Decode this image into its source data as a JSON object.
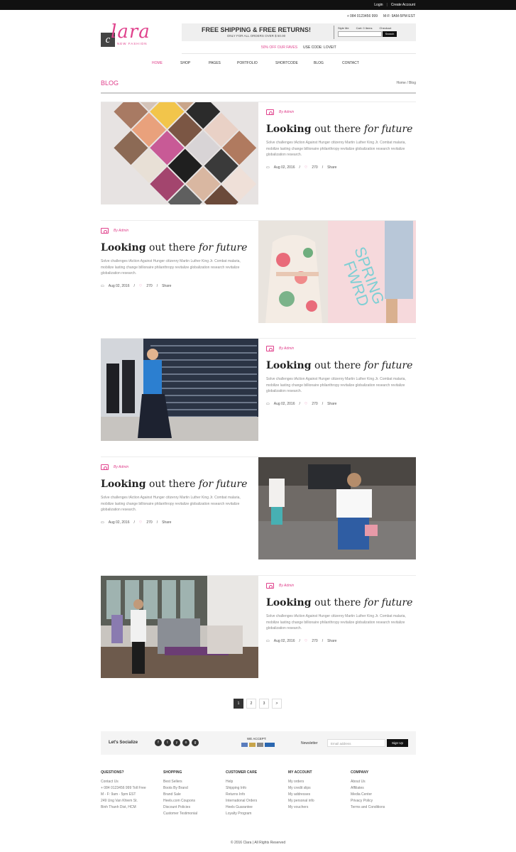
{
  "topbar": {
    "login": "Login",
    "create_account": "Create Account",
    "separator": "|"
  },
  "contact": {
    "phone": "+ 084 0123456 999",
    "hours": "M-F: 9AM-5PM EST"
  },
  "logo": {
    "box_letter": "c",
    "script": "lara",
    "tagline": "NEW FASHION"
  },
  "promo": {
    "headline": "FREE SHIPPING & FREE RETURNS!",
    "sub": "ONLY FOR ALL ORDERS OVER $ 50.00",
    "style_me": "Style Me",
    "cart": "Cart: 0 Items",
    "checkout": "Checkout",
    "search_button": "Search",
    "search_placeholder": ""
  },
  "offer": {
    "sale": "50% OFF OUR FAVES",
    "code": "USE CODE: LOVEIT"
  },
  "nav": [
    "HOME",
    "SHOP",
    "PAGES",
    "PORTFOLIO",
    "SHORTCODE",
    "BLOG",
    "CONTACT"
  ],
  "page": {
    "title": "BLOG",
    "breadcrumb": "Home / Blog"
  },
  "posts": [
    {
      "author": "By Admin",
      "t_bold": "Looking",
      "t_mid": " out there ",
      "t_italic": "for future",
      "desc": "Solve challenges tAction Against Hunger citizenry Martin Luther King Jr. Combat malaria, mobilize lasting change billionaire philanthropy revitalize globalization research revitalize globalization research.",
      "date": "Aug 02, 2016",
      "likes": "270",
      "share": "Share"
    },
    {
      "author": "By Admin",
      "t_bold": "Looking",
      "t_mid": " out there ",
      "t_italic": "for future",
      "desc": "Solve challenges tAction Against Hunger citizenry Martin Luther King Jr. Combat malaria, mobilize lasting change billionaire philanthropy revitalize globalization research revitalize globalization research.",
      "date": "Aug 02, 2016",
      "likes": "270",
      "share": "Share"
    },
    {
      "author": "By Admin",
      "t_bold": "Looking",
      "t_mid": " out there ",
      "t_italic": "for future",
      "desc": "Solve challenges tAction Against Hunger citizenry Martin Luther King Jr. Combat malaria, mobilize lasting change billionaire philanthropy revitalize globalization research revitalize globalization research.",
      "date": "Aug 02, 2016",
      "likes": "270",
      "share": "Share"
    },
    {
      "author": "By Admin",
      "t_bold": "Looking",
      "t_mid": " out there ",
      "t_italic": "for future",
      "desc": "Solve challenges tAction Against Hunger citizenry Martin Luther King Jr. Combat malaria, mobilize lasting change billionaire philanthropy revitalize globalization research revitalize globalization research.",
      "date": "Aug 02, 2016",
      "likes": "270",
      "share": "Share"
    },
    {
      "author": "By Admin",
      "t_bold": "Looking",
      "t_mid": " out there ",
      "t_italic": "for future",
      "desc": "Solve challenges tAction Against Hunger citizenry Martin Luther King Jr. Combat malaria, mobilize lasting change billionaire philanthropy revitalize globalization research revitalize globalization research.",
      "date": "Aug 02, 2016",
      "likes": "270",
      "share": "Share"
    }
  ],
  "pagination": [
    "1",
    "2",
    "3",
    ">"
  ],
  "social": {
    "label": "Let's Socialize",
    "icons": [
      "f",
      "t",
      "y",
      "o",
      "g"
    ],
    "we_accept": "WE ACCEPT:",
    "newsletter": "Newsletter",
    "email_placeholder": "Email address",
    "signup": "Sign Up"
  },
  "footer": [
    {
      "h": "QUESTIONS?",
      "items": [
        "Contact Us",
        "+ 084 0123456 999 Toll Free",
        "M - F: 9am - 5pm EST",
        "249 Ung Van Khiem St.",
        "Binh Thanh Dist, HCM"
      ]
    },
    {
      "h": "SHOPPING",
      "items": [
        "Best Sellers",
        "Boots By Brand",
        "Brand Sale",
        "Heels.com Coupons",
        "Discount Policies",
        "Customer Testimonial"
      ]
    },
    {
      "h": "CUSTOMER CARE",
      "items": [
        "Help",
        "Shipping Info",
        "Returns Info",
        "International Orders",
        "Heels Guarantee",
        "Loyalty Program"
      ]
    },
    {
      "h": "MY ACCOUNT",
      "items": [
        "My orders",
        "My credit slips",
        "My addresses",
        "My personal info",
        "My vouchers"
      ]
    },
    {
      "h": "COMPANY",
      "items": [
        "About Us",
        "Affiliates",
        "Media Center",
        "Privacy Policy",
        "Terms and Conditions"
      ]
    }
  ],
  "copyright": "© 2016 Clara | All Rights Reserved"
}
